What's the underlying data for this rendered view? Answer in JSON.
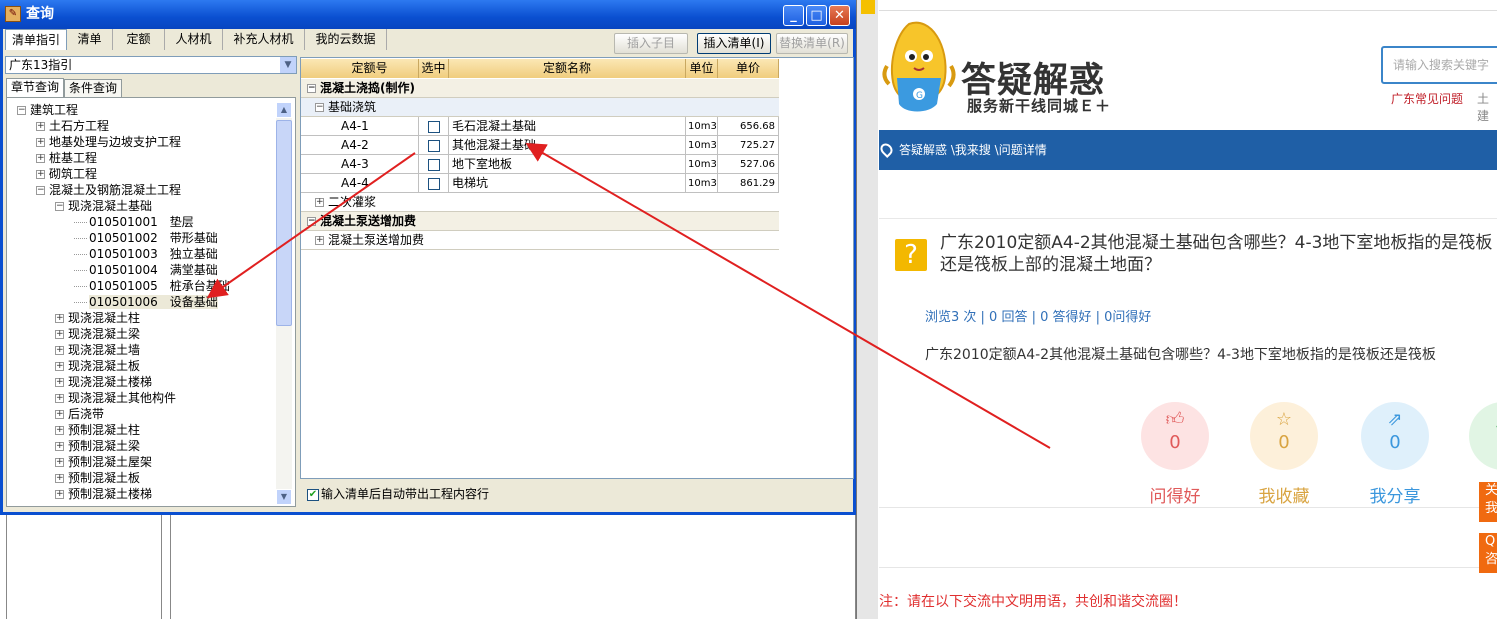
{
  "window": {
    "title": "查询",
    "tabs": [
      "清单指引",
      "清单",
      "定额",
      "人材机",
      "补充人材机",
      "我的云数据"
    ],
    "buttons": {
      "insert_child": "插入子目",
      "insert_list": "插入清单(I)",
      "replace_list": "替换清单(R)"
    },
    "guide_select": "广东13指引",
    "subtabs": [
      "章节查询",
      "条件查询"
    ],
    "tree": [
      {
        "label": "建筑工程",
        "state": "expanded"
      },
      {
        "label": "土石方工程",
        "state": "collapsed"
      },
      {
        "label": "地基处理与边坡支护工程",
        "state": "collapsed"
      },
      {
        "label": "桩基工程",
        "state": "collapsed"
      },
      {
        "label": "砌筑工程",
        "state": "collapsed"
      },
      {
        "label": "混凝土及钢筋混凝土工程",
        "state": "expanded"
      },
      {
        "label": "现浇混凝土基础",
        "state": "expanded"
      },
      {
        "label": "010501001　垫层",
        "state": "leaf"
      },
      {
        "label": "010501002　带形基础",
        "state": "leaf"
      },
      {
        "label": "010501003　独立基础",
        "state": "leaf"
      },
      {
        "label": "010501004　满堂基础",
        "state": "leaf"
      },
      {
        "label": "010501005　桩承台基础",
        "state": "leaf"
      },
      {
        "label": "010501006　设备基础",
        "state": "leaf",
        "selected": true
      },
      {
        "label": "现浇混凝土柱",
        "state": "collapsed"
      },
      {
        "label": "现浇混凝土梁",
        "state": "collapsed"
      },
      {
        "label": "现浇混凝土墙",
        "state": "collapsed"
      },
      {
        "label": "现浇混凝土板",
        "state": "collapsed"
      },
      {
        "label": "现浇混凝土楼梯",
        "state": "collapsed"
      },
      {
        "label": "现浇混凝土其他构件",
        "state": "collapsed"
      },
      {
        "label": "后浇带",
        "state": "collapsed"
      },
      {
        "label": "预制混凝土柱",
        "state": "collapsed"
      },
      {
        "label": "预制混凝土梁",
        "state": "collapsed"
      },
      {
        "label": "预制混凝土屋架",
        "state": "collapsed"
      },
      {
        "label": "预制混凝土板",
        "state": "collapsed"
      },
      {
        "label": "预制混凝土楼梯",
        "state": "collapsed"
      }
    ],
    "grid": {
      "headers": [
        "定额号",
        "选中",
        "定额名称",
        "单位",
        "单价"
      ],
      "group1": "混凝土浇捣(制作)",
      "subgroup1": "基础浇筑",
      "rows": [
        {
          "code": "A4-1",
          "name": "毛石混凝土基础",
          "unit": "10m3",
          "price": "656.68"
        },
        {
          "code": "A4-2",
          "name": "其他混凝土基础",
          "unit": "10m3",
          "price": "725.27"
        },
        {
          "code": "A4-3",
          "name": "地下室地板",
          "unit": "10m3",
          "price": "527.06"
        },
        {
          "code": "A4-4",
          "name": "电梯坑",
          "unit": "10m3",
          "price": "861.29"
        }
      ],
      "subgroup2": "二次灌浆",
      "group2": "混凝土泵送增加费",
      "subgroup3": "混凝土泵送增加费"
    },
    "footer_checkbox": "输入清单后自动带出工程内容行"
  },
  "site": {
    "logo_main": "答疑解惑",
    "logo_sub": "服务新干线同城Ｅ＋",
    "search_placeholder": "请输入搜索关键字",
    "hot_link1": "广东常见问题",
    "hot_link2": "土建",
    "breadcrumb": "答疑解惑 \\我来搜 \\问题详情",
    "question_title": "广东2010定额A4-2其他混凝土基础包含哪些？4-3地下室地板指的是筏板还是筏板上部的混凝土地面？",
    "stats": "浏览3 次 | 0 回答 | 0 答得好 | 0问得好",
    "question_body": "广东2010定额A4-2其他混凝土基础包含哪些？4-3地下室地板指的是筏板还是筏板",
    "actions": [
      {
        "label": "问得好",
        "count": "0",
        "icon": "thumbs-up-icon",
        "color": "#e05a5a",
        "bg": "#fde3e3"
      },
      {
        "label": "我收藏",
        "count": "0",
        "icon": "star-icon",
        "color": "#d9a441",
        "bg": "#fdf0da"
      },
      {
        "label": "我分享",
        "count": "0",
        "icon": "share-icon",
        "color": "#3b97dd",
        "bg": "#dff0fb"
      }
    ],
    "side_btn1": "关我",
    "side_btn2": "Q咨",
    "note": "注：请在以下交流中文明用语，共创和谐交流圈！"
  }
}
